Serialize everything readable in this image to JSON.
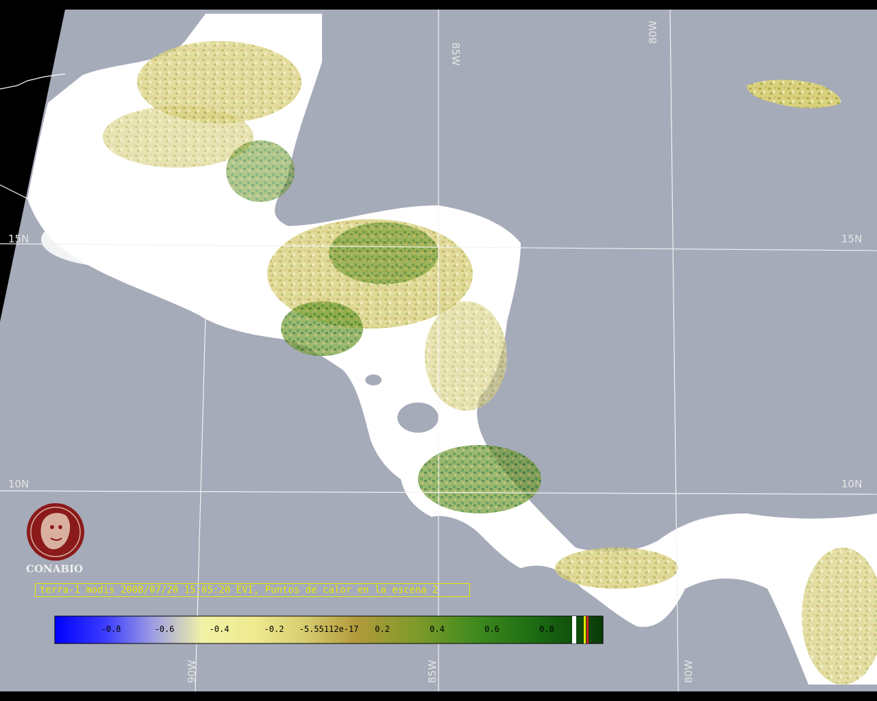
{
  "colors": {
    "ocean": "#a6abb9",
    "background": "#000000",
    "cloud": "#ffffff",
    "veg_low": "#d8cf7a",
    "veg_mid": "#b6a84a",
    "veg_high": "#2f7d1b",
    "graticule": "#f2f2f2",
    "caption": "#e8e800",
    "logo": "#8b1a1a"
  },
  "graticule": {
    "labels": {
      "lat_15_left": "15N",
      "lat_15_right": "15N",
      "lat_10_left": "10N",
      "lat_10_right": "10N",
      "lon_85_top": "85W",
      "lon_80_top": "80W",
      "lon_90_bottom": "90W",
      "lon_85_bottom": "85W",
      "lon_80_bottom": "80W"
    }
  },
  "logo": {
    "name": "CONABIO",
    "icon": "conabio-logo-icon"
  },
  "caption": "terra-1 modis 2008/07/20 15:05:20 EVI, Puntos de calor en la escena 2",
  "colorbar": {
    "ticks": [
      "-0.8",
      "-0.6",
      "-0.4",
      "-0.2",
      "-5.55112e-17",
      "0.2",
      "0.4",
      "0.6",
      "0.8"
    ]
  }
}
